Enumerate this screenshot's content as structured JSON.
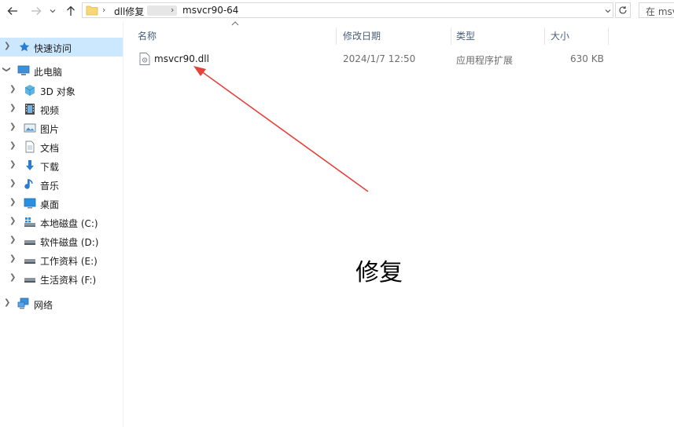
{
  "address_bar": {
    "crumbs": [
      "dll修复",
      "msvcr90-64"
    ],
    "search_placeholder": "在 msv"
  },
  "navigation": {
    "items": [
      {
        "label": "快速访问",
        "icon": "star-icon",
        "selected": true
      },
      {
        "label": "此电脑",
        "icon": "computer-icon",
        "expanded": true
      },
      {
        "label": "3D 对象",
        "icon": "cube-icon"
      },
      {
        "label": "视频",
        "icon": "film-icon"
      },
      {
        "label": "图片",
        "icon": "picture-icon"
      },
      {
        "label": "文档",
        "icon": "document-icon"
      },
      {
        "label": "下载",
        "icon": "download-icon"
      },
      {
        "label": "音乐",
        "icon": "music-icon"
      },
      {
        "label": "桌面",
        "icon": "desktop-icon"
      },
      {
        "label": "本地磁盘 (C:)",
        "icon": "windows-drive-icon"
      },
      {
        "label": "软件磁盘 (D:)",
        "icon": "drive-icon"
      },
      {
        "label": "工作资料 (E:)",
        "icon": "drive-icon"
      },
      {
        "label": "生活资料 (F:)",
        "icon": "drive-icon"
      },
      {
        "label": "网络",
        "icon": "network-icon"
      }
    ]
  },
  "columns": {
    "name": "名称",
    "modified": "修改日期",
    "type": "类型",
    "size": "大小"
  },
  "files": [
    {
      "name": "msvcr90.dll",
      "modified": "2024/1/7 12:50",
      "type": "应用程序扩展",
      "size": "630 KB",
      "icon": "dll-file-icon"
    }
  ],
  "annotation": {
    "text": "修复",
    "arrow_color": "#e8403a"
  }
}
